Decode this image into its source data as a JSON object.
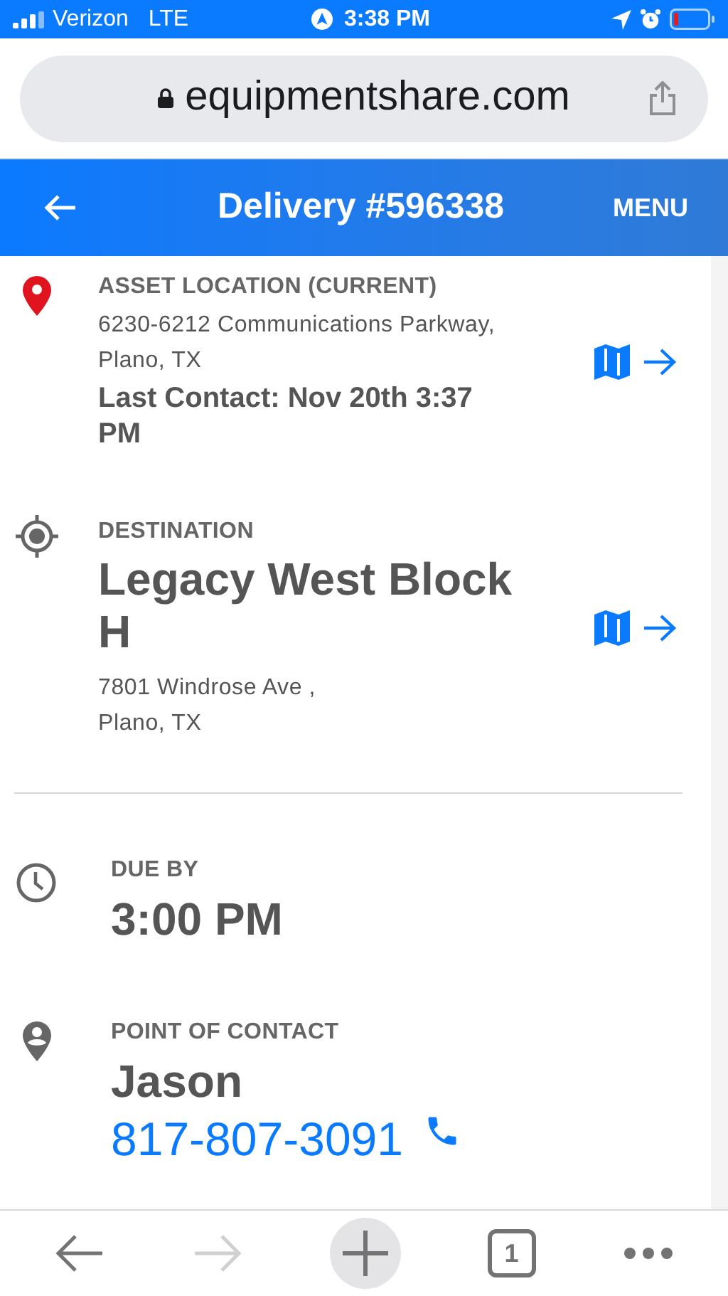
{
  "status_bar": {
    "carrier": "Verizon",
    "network": "LTE",
    "time": "3:38 PM"
  },
  "browser": {
    "url": "equipmentshare.com"
  },
  "header": {
    "title": "Delivery #596338",
    "menu": "MENU"
  },
  "asset_location": {
    "label": "ASSET LOCATION (CURRENT)",
    "address_lines": [
      "6230-6212 Communications Parkway,",
      "Plano, TX"
    ],
    "last_contact": "Last Contact: Nov 20th 3:37 PM"
  },
  "destination": {
    "label": "DESTINATION",
    "name": "Legacy West Block H",
    "address_lines": [
      "7801 Windrose Ave ,",
      "Plano, TX"
    ]
  },
  "due_by": {
    "label": "DUE BY",
    "time": "3:00 PM"
  },
  "point_of_contact": {
    "label": "POINT OF CONTACT",
    "name": "Jason",
    "phone": "817-807-3091"
  },
  "toolbar": [
    {
      "kind": "back",
      "disabled": false
    },
    {
      "kind": "forward",
      "disabled": true
    },
    {
      "kind": "new-tab",
      "disabled": false
    },
    {
      "kind": "tabs",
      "count": "1",
      "disabled": false
    },
    {
      "kind": "more",
      "disabled": false
    }
  ]
}
